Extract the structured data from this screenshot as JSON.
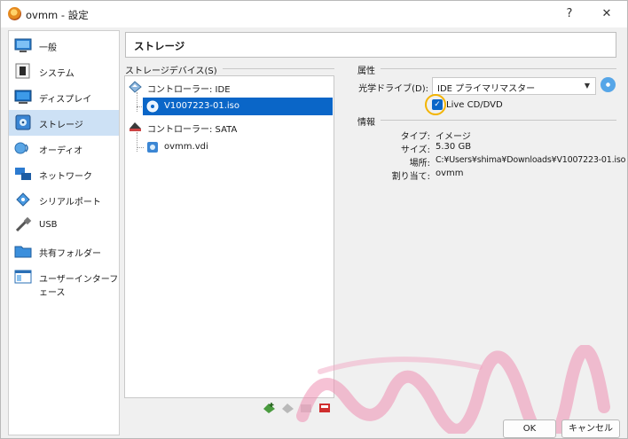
{
  "window": {
    "title": "ovmm - 設定",
    "help": "?",
    "close": "✕"
  },
  "sidebar": {
    "items": [
      {
        "label": "一般",
        "icon": "general-icon"
      },
      {
        "label": "システム",
        "icon": "system-chip-icon"
      },
      {
        "label": "ディスプレイ",
        "icon": "display-monitor-icon"
      },
      {
        "label": "ストレージ",
        "icon": "storage-disk-icon",
        "selected": true
      },
      {
        "label": "オーディオ",
        "icon": "audio-speaker-icon"
      },
      {
        "label": "ネットワーク",
        "icon": "network-icon"
      },
      {
        "label": "シリアルポート",
        "icon": "serial-port-icon"
      },
      {
        "label": "USB",
        "icon": "usb-icon"
      },
      {
        "label": "共有フォルダー",
        "icon": "shared-folder-icon"
      },
      {
        "label": "ユーザーインターフェース",
        "icon": "user-interface-icon"
      }
    ]
  },
  "page": {
    "title": "ストレージ"
  },
  "storage_devices": {
    "label": "ストレージデバイス(S)",
    "tree": [
      {
        "label": "コントローラー: IDE",
        "icon": "ide-controller-icon",
        "level": 0
      },
      {
        "label": "V1007223-01.iso",
        "icon": "optical-disc-icon",
        "level": 1,
        "selected": true
      },
      {
        "label": "コントローラー: SATA",
        "icon": "sata-controller-icon",
        "level": 0
      },
      {
        "label": "ovmm.vdi",
        "icon": "hard-disk-icon",
        "level": 1
      }
    ]
  },
  "attributes": {
    "label": "属性",
    "optical_drive_label": "光学ドライブ(D):",
    "optical_drive_value": "IDE プライマリマスター",
    "live_cd_label": "Live CD/DVD",
    "live_cd_checked": true
  },
  "info": {
    "label": "情報",
    "rows": [
      {
        "label": "タイプ:",
        "value": "イメージ"
      },
      {
        "label": "サイズ:",
        "value": "5.30 GB"
      },
      {
        "label": "場所:",
        "value": "C:¥Users¥shima¥Downloads¥V1007223-01.iso"
      },
      {
        "label": "割り当て:",
        "value": "ovmm"
      }
    ]
  },
  "buttons": {
    "ok": "OK",
    "cancel": "キャンセル"
  },
  "colors": {
    "selection": "#0a66c8",
    "sidebar_selection": "#cde1f5",
    "highlight_ring": "#f3b400",
    "watermark": "#ee8fb3"
  }
}
